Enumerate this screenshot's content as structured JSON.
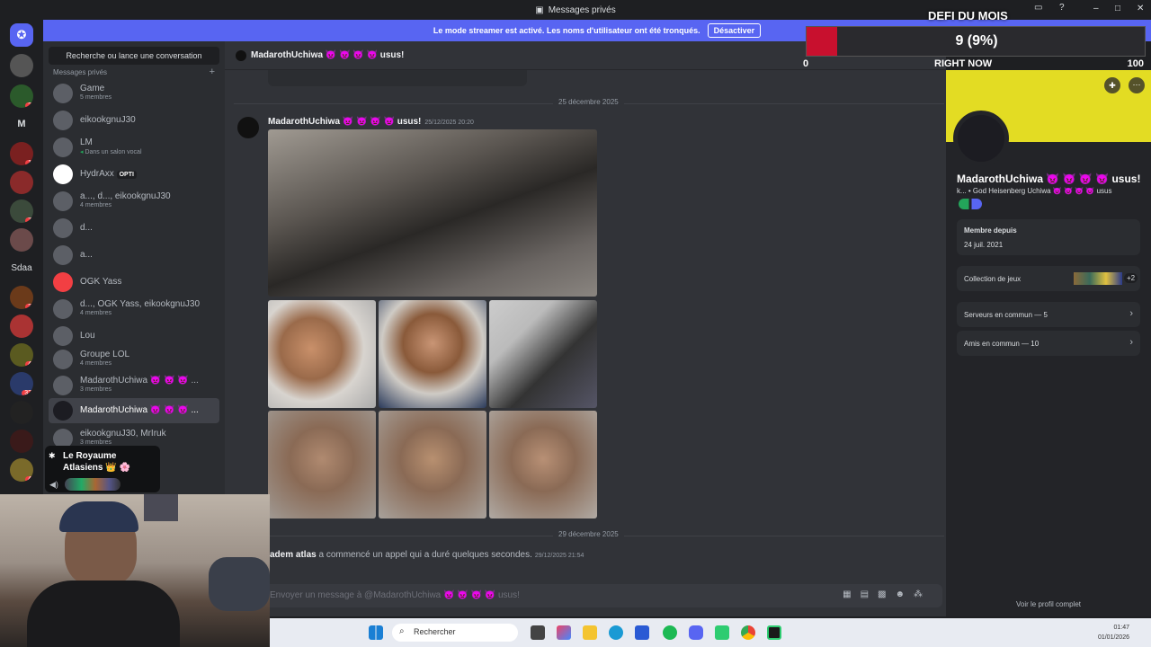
{
  "window": {
    "title": "Messages privés"
  },
  "banner": {
    "text": "Le mode streamer est activé. Les noms d'utilisateur ont été tronqués.",
    "button": "Désactiver"
  },
  "overlay": {
    "title": "DEFI DU MOIS",
    "value_text": "9 (9%)",
    "min": "0",
    "max": "100",
    "label": "RIGHT NOW",
    "progress_fraction": 0.09
  },
  "servers": {
    "text_items": [
      "M",
      "Sdaa"
    ],
    "badges": [
      "2",
      "1",
      "7",
      "3",
      "4",
      "32",
      "4"
    ]
  },
  "dm_sidebar": {
    "search_placeholder": "Recherche ou lance une conversation",
    "header": "Messages privés",
    "items": [
      {
        "name": "Game",
        "sub": "5 membres"
      },
      {
        "name": "eikookgnuJ30",
        "sub": ""
      },
      {
        "name": "LM",
        "sub": "Dans un salon vocal"
      },
      {
        "name": "HydrAxx",
        "sub": "",
        "tag": "OPTI"
      },
      {
        "name": "a..., d..., eikookgnuJ30",
        "sub": "4 membres"
      },
      {
        "name": "d...",
        "sub": ""
      },
      {
        "name": "a...",
        "sub": ""
      },
      {
        "name": "OGK Yass",
        "sub": ""
      },
      {
        "name": "d..., OGK Yass, eikookgnuJ30",
        "sub": "4 membres"
      },
      {
        "name": "Lou",
        "sub": ""
      },
      {
        "name": "Groupe LOL",
        "sub": "4 membres"
      },
      {
        "name": "MadarothUchiwa 👿 👿 👿 ...",
        "sub": "3 membres"
      },
      {
        "name": "MadarothUchiwa 👿 👿 👿 ...",
        "sub": "",
        "selected": true
      },
      {
        "name": "eikookgnuJ30, MrIruk",
        "sub": "3 membres"
      }
    ]
  },
  "voice_popup": {
    "server": "Le Royaume Atlasiens 👑 🌸"
  },
  "chat": {
    "header_name": "MadarothUchiwa 👿 👿 👿 👿 usus!",
    "date1": "25 décembre 2025",
    "message": {
      "author": "MadarothUchiwa 👿 👿 👿 👿 usus!",
      "timestamp": "25/12/2025 20:20"
    },
    "date2": "29 décembre 2025",
    "call": {
      "author": "adem atlas",
      "text": "a commencé un appel qui a duré quelques secondes.",
      "timestamp": "29/12/2025 21:54"
    },
    "composer_placeholder": "Envoyer un message à @MadarothUchiwa 👿 👿 👿 👿 usus!"
  },
  "profile": {
    "name": "MadarothUchiwa 👿 👿 👿 👿 usus!",
    "subline": "k... • God Heisenberg Uchiwa 👿 👿 👿 👿 usus",
    "member_since_label": "Membre depuis",
    "member_since": "24 juil. 2021",
    "games_label": "Collection de jeux",
    "games_more": "+2",
    "servers_common": "Serveurs en commun — 5",
    "friends_common": "Amis en commun — 10",
    "full_profile": "Voir le profil complet"
  },
  "taskbar": {
    "search": "Rechercher",
    "time": "01:47",
    "date": "01/01/2026"
  },
  "colors": {
    "accent": "#5865f2",
    "overlay_fill": "#c8102e",
    "profile_banner": "#e3dc23"
  }
}
